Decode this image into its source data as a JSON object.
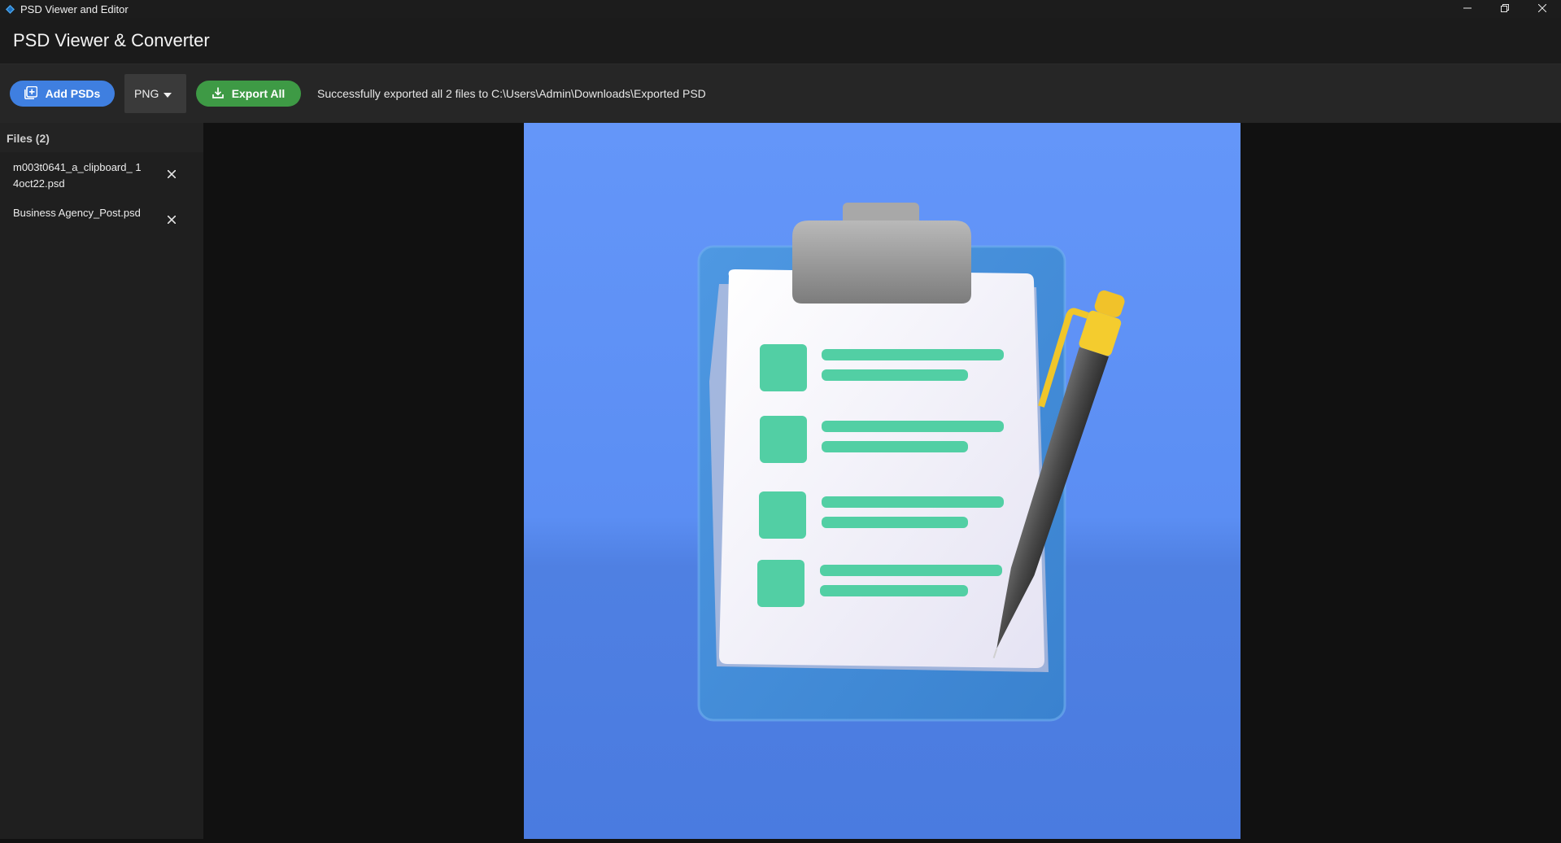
{
  "window": {
    "title": "PSD Viewer and Editor",
    "controls": [
      "minimize-icon",
      "restore-icon",
      "close-icon"
    ]
  },
  "header": {
    "app_title": "PSD Viewer & Converter"
  },
  "toolbar": {
    "add_label": "Add PSDs",
    "format_value": "PNG",
    "export_label": "Export All",
    "status_text": "Successfully exported all 2 files to C:\\Users\\Admin\\Downloads\\Exported PSD",
    "colors": {
      "add": "#3f7fe0",
      "export": "#3e9a45"
    }
  },
  "sidebar": {
    "files_header": "Files (2)",
    "files": [
      {
        "name": "m003t0641_a_clipboard_ 14oct22.psd"
      },
      {
        "name": "Business Agency_Post.psd"
      }
    ]
  },
  "preview": {
    "subject": "clipboard-checklist-with-pen-illustration",
    "background": "#5b8ef2"
  }
}
